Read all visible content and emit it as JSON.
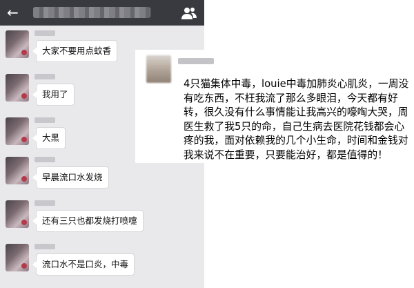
{
  "chat": {
    "back_icon": "arrow-left-icon",
    "group_icon": "group-members-icon",
    "messages": [
      {
        "text": "大家不要用点蚊香"
      },
      {
        "text": "我用了"
      },
      {
        "text": "大黑"
      },
      {
        "text": "早晨流口水发烧"
      },
      {
        "text": "还有三只也都发烧打喷嚏"
      },
      {
        "text": "流口水不是口炎，中毒"
      }
    ]
  },
  "post": {
    "text": "4只猫集体中毒，louie中毒加肺炎心肌炎，一周没有吃东西，不枉我流了那么多眼泪，今天都有好转，很久没有什么事情能让我高兴的嚎啕大哭，周医生救了我5只的命，自己生病去医院花钱都会心疼的我，面对依赖我的几个小生命，时间和金钱对我来说不在重要，只要能治好，都是值得的！"
  },
  "colors": {
    "topbar": "#393a3f",
    "chat_background": "#e9e9ec",
    "bubble": "#ffffff"
  }
}
